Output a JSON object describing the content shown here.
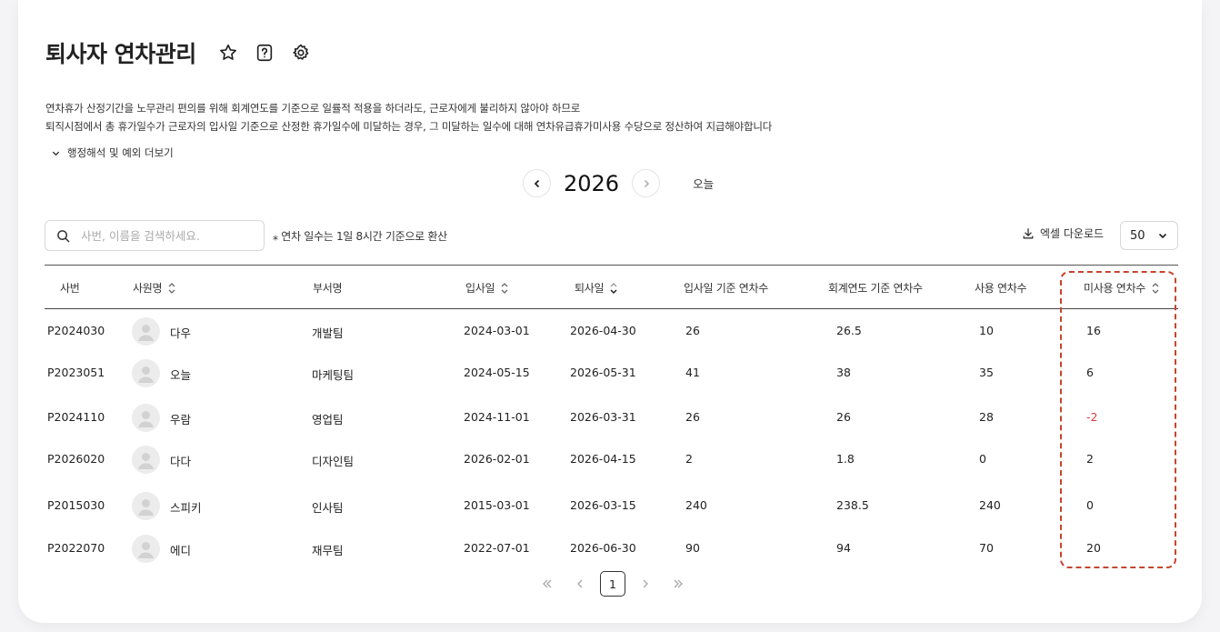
{
  "header": {
    "title": "퇴사자 연차관리",
    "description_line1": "연차휴가 산정기간을 노무관리 편의를 위해 회계연도를 기준으로 일률적 적용을 하더라도, 근로자에게 불리하지 않아야 하므로",
    "description_line2": "퇴직시점에서 총 휴가일수가 근로자의 입사일 기준으로 산정한 휴가일수에 미달하는 경우, 그 미달하는 일수에 대해 연차유급휴가미사용 수당으로 정산하여 지급해야합니다",
    "more_label": "행정해석 및 예외 더보기"
  },
  "year_nav": {
    "year": "2026",
    "today_label": "오늘"
  },
  "toolbar": {
    "search_placeholder": "사번, 이름을 검색하세요.",
    "note": "⁎ 연차 일수는 1일 8시간 기준으로 환산",
    "excel_label": "엑셀 다운로드",
    "page_size": "50"
  },
  "table": {
    "headers": {
      "emp_no": "사번",
      "name": "사원명",
      "dept": "부서명",
      "join_date": "입사일",
      "leave_date": "퇴사일",
      "join_based": "입사일 기준 연차수",
      "fiscal_based": "회계연도 기준 연차수",
      "used": "사용 연차수",
      "unused": "미사용 연차수"
    },
    "rows": [
      {
        "emp_no": "P2024030",
        "name": "다우",
        "dept": "개발팀",
        "join_date": "2024-03-01",
        "leave_date": "2026-04-30",
        "join_based": "26",
        "fiscal_based": "26.5",
        "used": "10",
        "unused": "16"
      },
      {
        "emp_no": "P2023051",
        "name": "오늘",
        "dept": "마케팅팀",
        "join_date": "2024-05-15",
        "leave_date": "2026-05-31",
        "join_based": "41",
        "fiscal_based": "38",
        "used": "35",
        "unused": "6"
      },
      {
        "emp_no": "P2024110",
        "name": "우람",
        "dept": "영업팀",
        "join_date": "2024-11-01",
        "leave_date": "2026-03-31",
        "join_based": "26",
        "fiscal_based": "26",
        "used": "28",
        "unused": "-2"
      },
      {
        "emp_no": "P2026020",
        "name": "다다",
        "dept": "디자인팀",
        "join_date": "2026-02-01",
        "leave_date": "2026-04-15",
        "join_based": "2",
        "fiscal_based": "1.8",
        "used": "0",
        "unused": "2"
      },
      {
        "emp_no": "P2015030",
        "name": "스피키",
        "dept": "인사팀",
        "join_date": "2015-03-01",
        "leave_date": "2026-03-15",
        "join_based": "240",
        "fiscal_based": "238.5",
        "used": "240",
        "unused": "0"
      },
      {
        "emp_no": "P2022070",
        "name": "에디",
        "dept": "재무팀",
        "join_date": "2022-07-01",
        "leave_date": "2026-06-30",
        "join_based": "90",
        "fiscal_based": "94",
        "used": "70",
        "unused": "20"
      }
    ]
  },
  "pagination": {
    "current": "1"
  },
  "colors": {
    "negative": "#d5403a",
    "highlight_border": "#c6452f"
  }
}
